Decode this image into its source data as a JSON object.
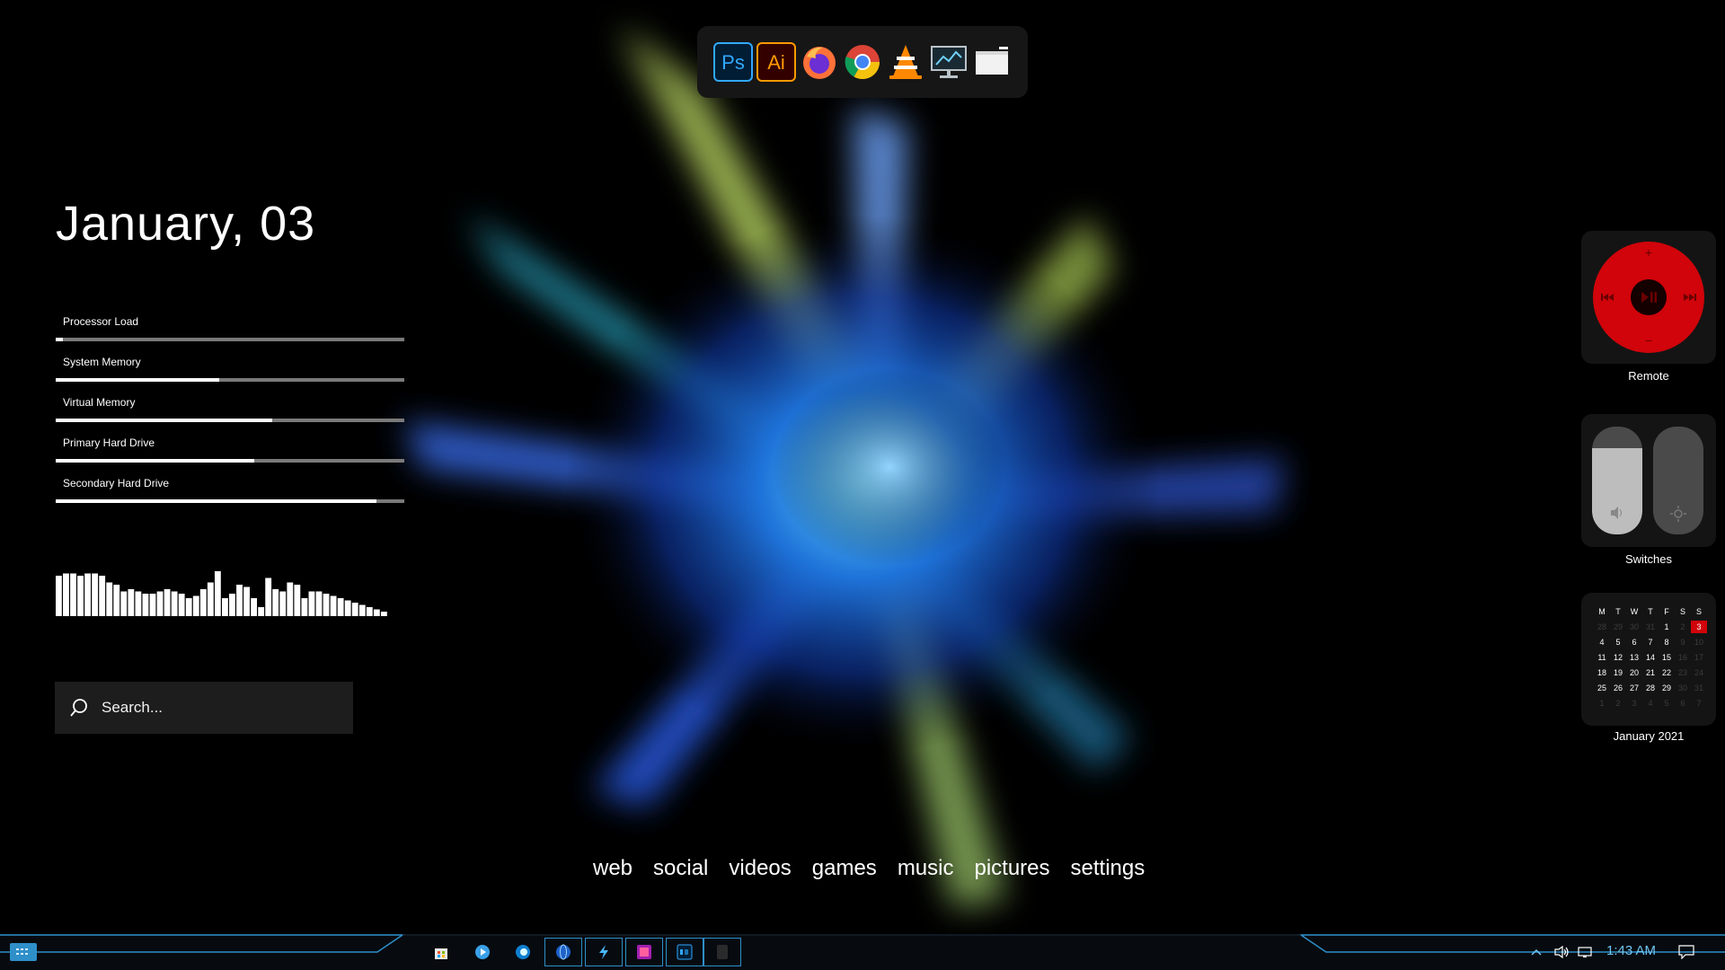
{
  "dock": {
    "icons": [
      "photoshop-icon",
      "illustrator-icon",
      "firefox-icon",
      "chrome-icon",
      "vlc-icon",
      "monitor-icon",
      "window-icon"
    ],
    "photoshop_label": "Ps",
    "illustrator_label": "Ai"
  },
  "date_text": "January, 03",
  "system_meters": [
    {
      "label": "Processor Load",
      "fraction": 0.02
    },
    {
      "label": "System Memory",
      "fraction": 0.47
    },
    {
      "label": "Virtual Memory",
      "fraction": 0.62
    },
    {
      "label": "Primary Hard Drive",
      "fraction": 0.57
    },
    {
      "label": "Secondary Hard Drive",
      "fraction": 0.92
    }
  ],
  "audio_visualizer_levels": [
    0.9,
    0.95,
    0.95,
    0.9,
    0.95,
    0.95,
    0.9,
    0.75,
    0.7,
    0.55,
    0.6,
    0.55,
    0.5,
    0.5,
    0.55,
    0.6,
    0.55,
    0.5,
    0.4,
    0.45,
    0.6,
    0.75,
    1.0,
    0.4,
    0.5,
    0.7,
    0.65,
    0.4,
    0.2,
    0.85,
    0.6,
    0.55,
    0.75,
    0.7,
    0.4,
    0.55,
    0.55,
    0.5,
    0.45,
    0.4,
    0.35,
    0.3,
    0.25,
    0.2,
    0.15,
    0.1
  ],
  "search": {
    "placeholder": "Search..."
  },
  "nav_links": [
    "web",
    "social",
    "videos",
    "games",
    "music",
    "pictures",
    "settings"
  ],
  "widgets": {
    "remote": {
      "caption": "Remote",
      "plus": "+",
      "minus": "−",
      "color": "#d0040a"
    },
    "switches": {
      "caption": "Switches"
    },
    "calendar": {
      "caption": "January 2021",
      "weekdays": [
        "M",
        "T",
        "W",
        "T",
        "F",
        "S",
        "S"
      ],
      "weeks": [
        [
          "28",
          "29",
          "30",
          "31",
          "1",
          "2",
          "3"
        ],
        [
          "4",
          "5",
          "6",
          "7",
          "8",
          "9",
          "10"
        ],
        [
          "11",
          "12",
          "13",
          "14",
          "15",
          "16",
          "17"
        ],
        [
          "18",
          "19",
          "20",
          "21",
          "22",
          "23",
          "24"
        ],
        [
          "25",
          "26",
          "27",
          "28",
          "29",
          "30",
          "31"
        ],
        [
          "1",
          "2",
          "3",
          "4",
          "5",
          "6",
          "7"
        ]
      ],
      "today": "3"
    }
  },
  "taskbar": {
    "clock": "1:43 AM",
    "accent": "#2f8fc9",
    "pinned": [
      "store-icon",
      "media-player-icon",
      "edge-icon"
    ],
    "open": [
      "globe-icon",
      "lightning-icon",
      "photo-app-icon",
      "photoshop-icon",
      "app-icon"
    ],
    "tray": [
      "chevron-up-icon",
      "volume-icon",
      "network-icon",
      "notification-icon"
    ]
  }
}
